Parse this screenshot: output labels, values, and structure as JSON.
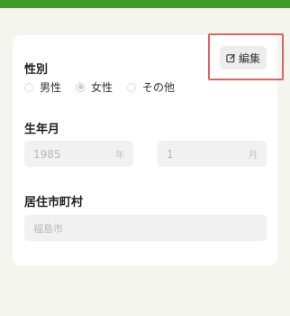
{
  "edit_button": {
    "label": "編集"
  },
  "gender": {
    "label": "性別",
    "options": [
      {
        "label": "男性",
        "checked": false
      },
      {
        "label": "女性",
        "checked": true
      },
      {
        "label": "その他",
        "checked": false
      }
    ]
  },
  "birth": {
    "label": "生年月",
    "year_value": "1985",
    "year_unit": "年",
    "month_value": "1",
    "month_unit": "月"
  },
  "city": {
    "label": "居住市町村",
    "value": "福島市"
  },
  "colors": {
    "topbar": "#3f9a2a",
    "highlight": "#e06262"
  }
}
